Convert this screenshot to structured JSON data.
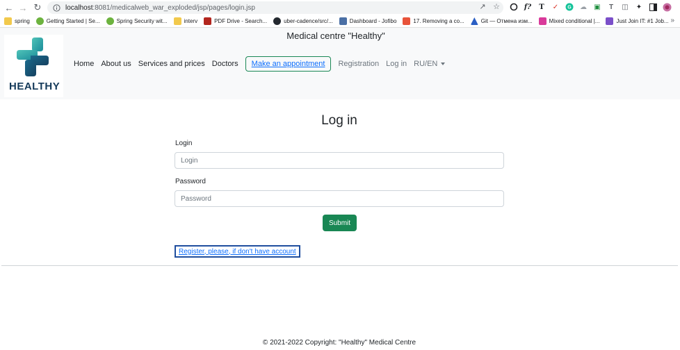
{
  "browser": {
    "url_host": "localhost",
    "url_path": ":8081/medicalweb_war_exploded/jsp/pages/login.jsp",
    "bookmarks": [
      {
        "label": "spring",
        "color": "#f2c94c"
      },
      {
        "label": "Getting Started | Se...",
        "color": "#6db33f"
      },
      {
        "label": "Spring Security wit...",
        "color": "#6db33f"
      },
      {
        "label": "interv",
        "color": "#f2c94c"
      },
      {
        "label": "PDF Drive - Search...",
        "color": "#b3261e"
      },
      {
        "label": "uber-cadence/src/...",
        "color": "#24292f"
      },
      {
        "label": "Dashboard - Jofibo",
        "color": "#4a6fa5"
      },
      {
        "label": "17. Removing a co...",
        "color": "#e8533a"
      },
      {
        "label": "Git — Отмена изм...",
        "color": "#2b5fc4"
      },
      {
        "label": "Mixed conditional |...",
        "color": "#d93a9a"
      },
      {
        "label": "Just Join IT: #1 Job...",
        "color": "#7b4fc9"
      }
    ],
    "more": "»"
  },
  "header": {
    "site_title": "Medical centre \"Healthy\"",
    "logo_text": "HEALTHY",
    "nav": {
      "home": "Home",
      "about": "About us",
      "services": "Services and prices",
      "doctors": "Doctors",
      "appointment": "Make an appointment",
      "registration": "Registration",
      "login": "Log in",
      "lang": "RU/EN"
    }
  },
  "form": {
    "title": "Log in",
    "login_label": "Login",
    "login_placeholder": "Login",
    "password_label": "Password",
    "password_placeholder": "Password",
    "submit": "Submit",
    "register_link": "Register, please, if don't have account"
  },
  "footer": {
    "copyright": "© 2021-2022 Copyright: \"Healthy\" Medical Centre"
  }
}
